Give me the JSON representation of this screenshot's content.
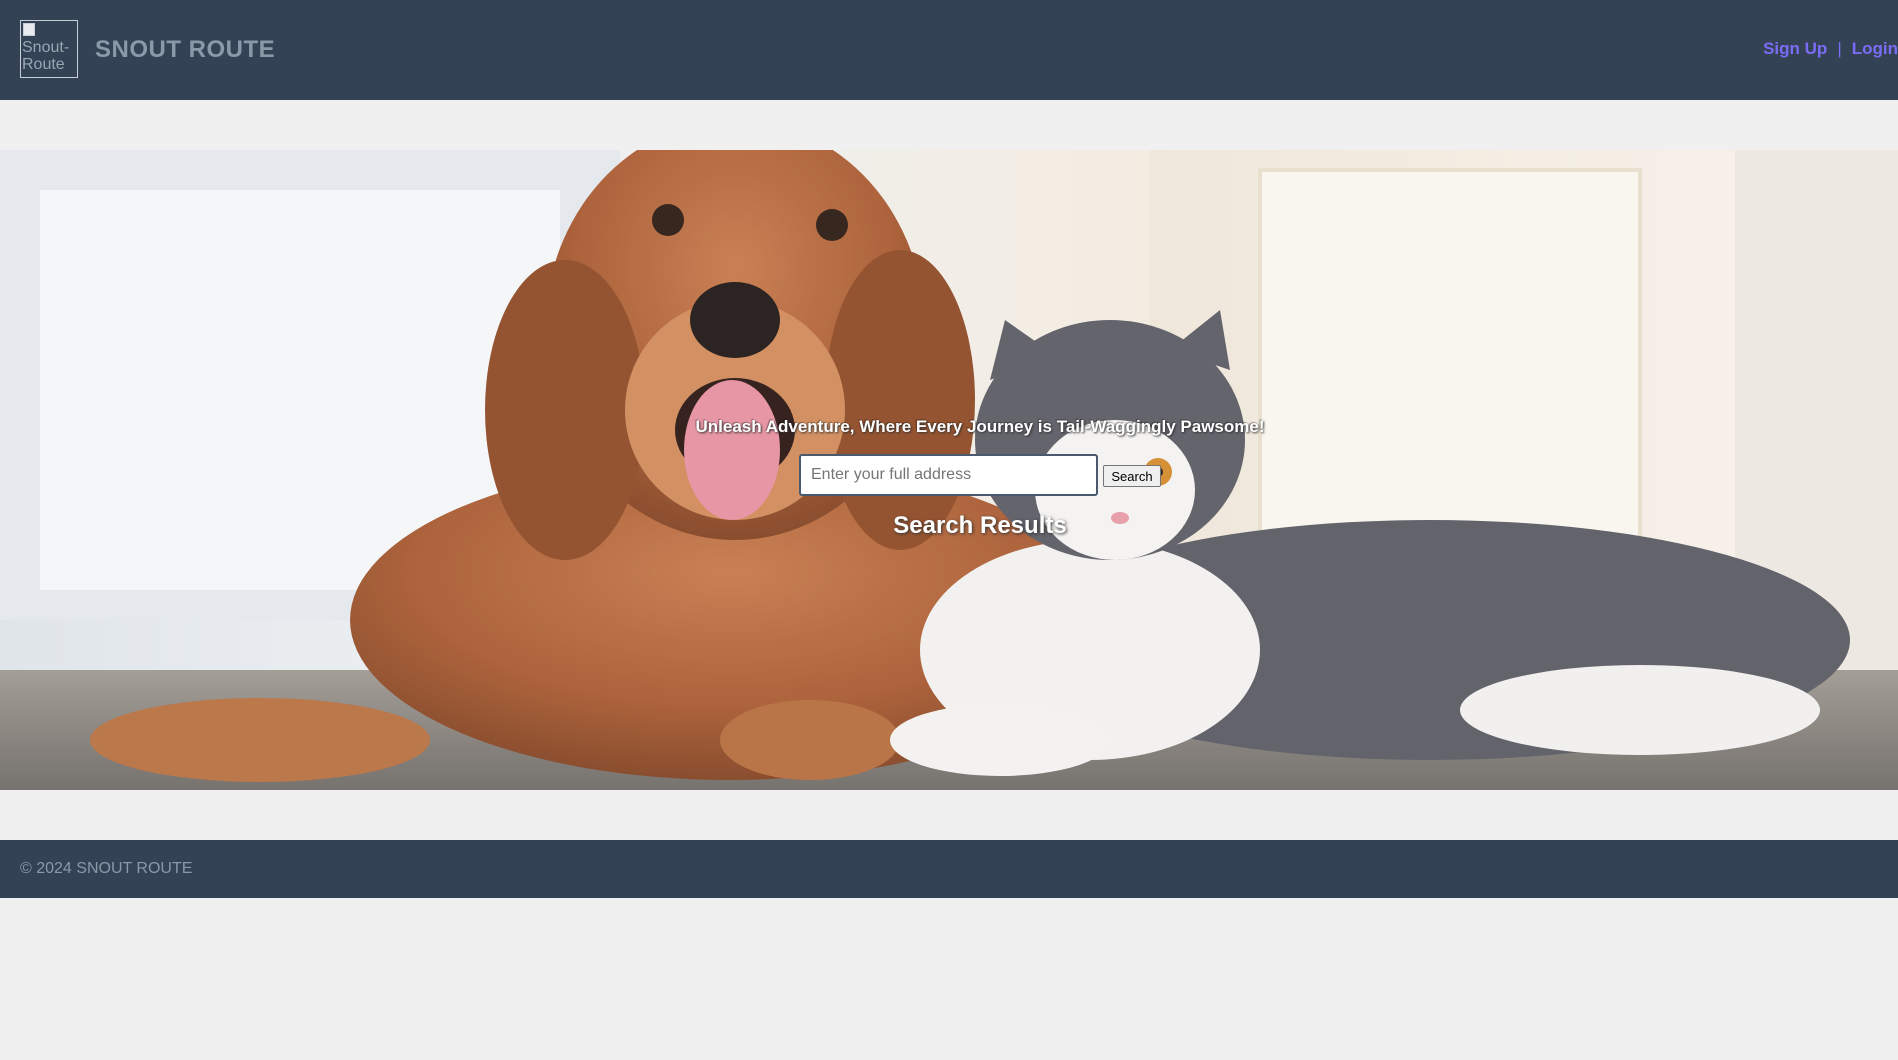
{
  "header": {
    "logo_alt": "Snout-Route",
    "brand": "SNOUT ROUTE",
    "signup_label": "Sign Up",
    "separator": "|",
    "login_label": "Login"
  },
  "hero": {
    "tagline": "Unleash Adventure, Where Every Journey is Tail-Waggingly Pawsome!",
    "search": {
      "placeholder": "Enter your full address",
      "value": "",
      "button_label": "Search"
    },
    "results_title": "Search Results",
    "background_image": "golden-retriever-and-grey-cat-lying-on-floor"
  },
  "footer": {
    "copyright": "© 2024 SNOUT ROUTE"
  },
  "colors": {
    "header_bg": "#334355",
    "page_bg": "#f0f0f0",
    "link": "#7b6cf6",
    "muted_text": "#8b98a8"
  }
}
